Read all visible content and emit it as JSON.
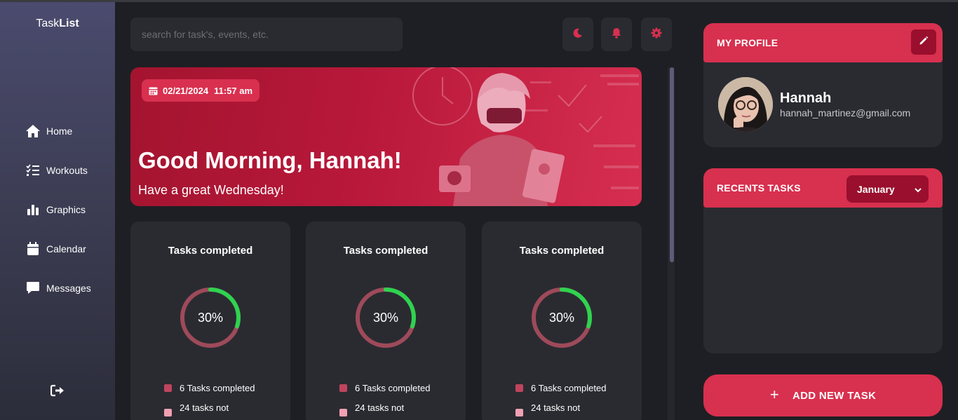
{
  "app": {
    "logo_prefix": "Task",
    "logo_bold": "List"
  },
  "sidebar": {
    "items": [
      {
        "label": "Home",
        "icon": "home-icon"
      },
      {
        "label": "Workouts",
        "icon": "checklist-icon"
      },
      {
        "label": "Graphics",
        "icon": "bar-chart-icon"
      },
      {
        "label": "Calendar",
        "icon": "calendar-icon"
      },
      {
        "label": "Messages",
        "icon": "message-icon"
      }
    ],
    "logout_icon": "logout-icon"
  },
  "search": {
    "placeholder": "search for task's, events, etc."
  },
  "toolbar": {
    "icons": [
      "moon-icon",
      "bell-icon",
      "gear-icon"
    ],
    "accent": "#d8304f"
  },
  "banner": {
    "date": "02/21/2024",
    "time": "11:57 am",
    "greeting": "Good Morning, Hannah!",
    "subtitle": "Have a great Wednesday!"
  },
  "cards": [
    {
      "title": "Tasks completed",
      "percent_label": "30%",
      "progress": 0.3,
      "legend_completed": "6 Tasks completed",
      "legend_not": "24 tasks not"
    },
    {
      "title": "Tasks completed",
      "percent_label": "30%",
      "progress": 0.3,
      "legend_completed": "6 Tasks completed",
      "legend_not": "24 tasks not"
    },
    {
      "title": "Tasks completed",
      "percent_label": "30%",
      "progress": 0.3,
      "legend_completed": "6 Tasks completed",
      "legend_not": "24 tasks not"
    }
  ],
  "colors": {
    "progress": "#2fd34f",
    "ring": "#9e4a5a",
    "completed_swatch": "#c0445e",
    "not_swatch": "#f0a0b2"
  },
  "profile": {
    "header": "MY PROFILE",
    "name": "Hannah",
    "email": "hannah_martinez@gmail.com"
  },
  "recent": {
    "header": "RECENTS TASKS",
    "month": "January"
  },
  "add_task": {
    "label": "ADD NEW TASK"
  }
}
